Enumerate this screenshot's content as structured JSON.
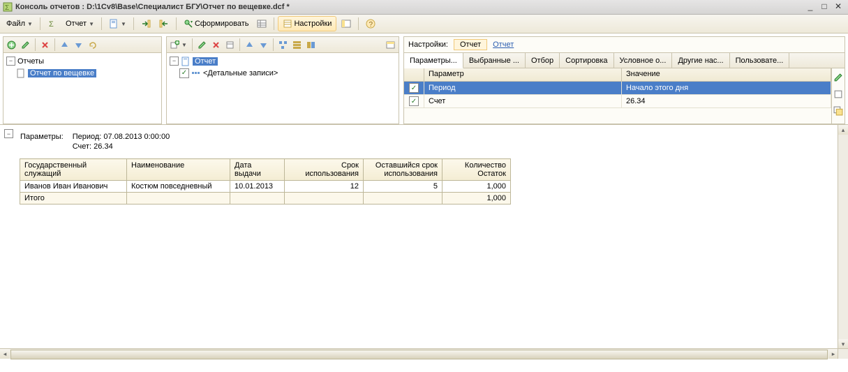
{
  "title": "Консоль отчетов : D:\\1Cv8\\Base\\Специалист БГУ\\Отчет по вещевке.dcf *",
  "toolbar": {
    "file": "Файл",
    "report": "Отчет",
    "form": "Сформировать",
    "settings": "Настройки"
  },
  "tree1": {
    "root": "Отчеты",
    "item": "Отчет по вещевке"
  },
  "tree2": {
    "root": "Отчет",
    "detail": "<Детальные записи>"
  },
  "settingsHead": {
    "label": "Настройки:",
    "sel": "Отчет",
    "link": "Отчет"
  },
  "tabs": [
    "Параметры...",
    "Выбранные ...",
    "Отбор",
    "Сортировка",
    "Условное о...",
    "Другие нас...",
    "Пользовате..."
  ],
  "paramHeader": {
    "p": "Параметр",
    "v": "Значение"
  },
  "params": [
    {
      "name": "Период",
      "value": "Начало этого дня",
      "sel": true
    },
    {
      "name": "Счет",
      "value": "26.34",
      "sel": false
    }
  ],
  "report": {
    "paramLabel": "Параметры:",
    "paramLine1": "Период: 07.08.2013 0:00:00",
    "paramLine2": "Счет: 26.34",
    "cols": [
      "Государственный служащий",
      "Наименование",
      "Дата выдачи",
      "Срок использования",
      "Оставшийся срок использования",
      "Количество Остаток"
    ],
    "row": {
      "c1": "Иванов Иван Иванович",
      "c2": "Костюм повседневный",
      "c3": "10.01.2013",
      "c4": "12",
      "c5": "5",
      "c6": "1,000"
    },
    "totalLabel": "Итого",
    "totalVal": "1,000"
  }
}
